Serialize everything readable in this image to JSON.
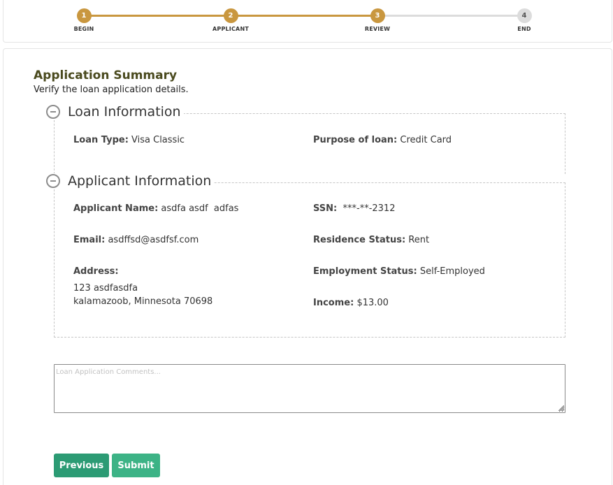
{
  "progress": {
    "steps": [
      {
        "number": "1",
        "label": "BEGIN",
        "state": "done"
      },
      {
        "number": "2",
        "label": "APPLICANT",
        "state": "done"
      },
      {
        "number": "3",
        "label": "REVIEW",
        "state": "done"
      },
      {
        "number": "4",
        "label": "END",
        "state": "todo"
      }
    ],
    "colors": {
      "done": "#c9973f",
      "todo": "#dcdcdc"
    }
  },
  "summary": {
    "title": "Application Summary",
    "subtitle": "Verify the loan application details."
  },
  "loan_section": {
    "title": "Loan Information",
    "loan_type_label": "Loan Type:",
    "loan_type_value": "Visa Classic",
    "purpose_label": "Purpose of loan:",
    "purpose_value": "Credit Card"
  },
  "applicant_section": {
    "title": "Applicant Information",
    "name_label": "Applicant Name:",
    "name_value": "asdfa asdf  adfas",
    "ssn_label": "SSN:",
    "ssn_value": "***-**-2312",
    "email_label": "Email:",
    "email_value": "asdffsd@asdfsf.com",
    "residence_label": "Residence Status:",
    "residence_value": "Rent",
    "address_label": "Address:",
    "address_line1": "123 asdfasdfa",
    "address_line2": "kalamazoob, Minnesota 70698",
    "employment_label": "Employment Status:",
    "employment_value": "Self-Employed",
    "income_label": "Income:",
    "income_value": "$13.00"
  },
  "comments": {
    "placeholder": "Loan Application Comments...",
    "value": ""
  },
  "buttons": {
    "previous": "Previous",
    "submit": "Submit"
  }
}
